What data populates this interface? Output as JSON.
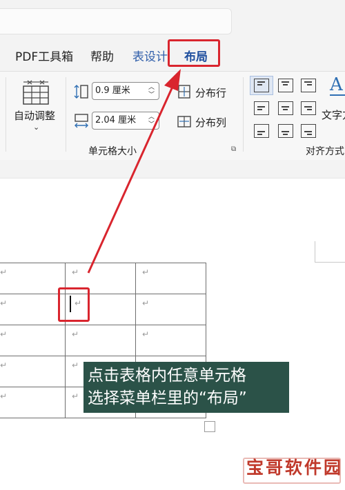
{
  "menu": {
    "tabs": [
      {
        "label": "PDF工具箱"
      },
      {
        "label": "帮助"
      },
      {
        "label": "表设计"
      },
      {
        "label": "布局"
      }
    ]
  },
  "ribbon": {
    "autofit_label": "自动调整",
    "height_value": "0.9 厘米",
    "width_value": "2.04 厘米",
    "distribute_rows": "分布行",
    "distribute_cols": "分布列",
    "cell_size_group": "单元格大小",
    "text_direction": "文字方",
    "alignment_group": "对齐方式"
  },
  "doc": {
    "para_mark": "↵"
  },
  "caption": {
    "line1": "点击表格内任意单元格",
    "line2": "选择菜单栏里的“布局”"
  },
  "watermark": "宝哥软件园",
  "colors": {
    "highlight": "#d9252e",
    "accent_tab": "#1f4f9e",
    "caption_bg": "#2b5248"
  }
}
